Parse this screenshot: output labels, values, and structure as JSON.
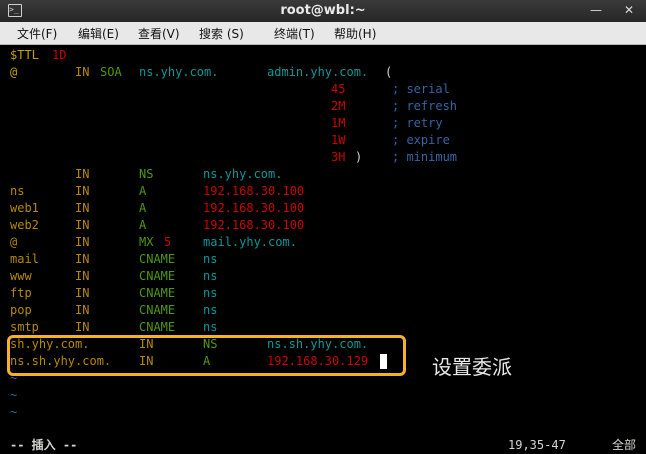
{
  "window": {
    "title": "root@wbl:~",
    "minimize": "—",
    "close": "✕",
    "terminal_icon": ">_"
  },
  "menu": [
    "文件(F)",
    "编辑(E)",
    "查看(V)",
    "搜索 (S)",
    "终端(T)",
    "帮助(H)"
  ],
  "file": {
    "ttl_key": "$TTL",
    "ttl_val": "1D",
    "soa": {
      "origin": "@",
      "class": "IN",
      "type": "SOA",
      "ns": "ns.yhy.com.",
      "admin": "admin.yhy.com.",
      "open": "("
    },
    "soa_fields": [
      {
        "value": "45",
        "close": "",
        "comment": "; serial"
      },
      {
        "value": "2M",
        "close": "",
        "comment": "; refresh"
      },
      {
        "value": "1M",
        "close": "",
        "comment": "; retry"
      },
      {
        "value": "1W",
        "close": "",
        "comment": "; expire"
      },
      {
        "value": "3H",
        "close": ")",
        "comment": "; minimum"
      }
    ],
    "records": [
      {
        "name": "",
        "class": "IN",
        "type": "NS",
        "pref": "",
        "data": "ns.yhy.com."
      },
      {
        "name": "ns",
        "class": "IN",
        "type": "A",
        "pref": "",
        "data": "192.168.30.100"
      },
      {
        "name": "web1",
        "class": "IN",
        "type": "A",
        "pref": "",
        "data": "192.168.30.100"
      },
      {
        "name": "web2",
        "class": "IN",
        "type": "A",
        "pref": "",
        "data": "192.168.30.100"
      },
      {
        "name": "@",
        "class": "IN",
        "type": "MX",
        "pref": "5",
        "data": "mail.yhy.com."
      },
      {
        "name": "mail",
        "class": "IN",
        "type": "CNAME",
        "pref": "",
        "data": "ns"
      },
      {
        "name": "www",
        "class": "IN",
        "type": "CNAME",
        "pref": "",
        "data": "ns"
      },
      {
        "name": "ftp",
        "class": "IN",
        "type": "CNAME",
        "pref": "",
        "data": "ns"
      },
      {
        "name": "pop",
        "class": "IN",
        "type": "CNAME",
        "pref": "",
        "data": "ns"
      },
      {
        "name": "smtp",
        "class": "IN",
        "type": "CNAME",
        "pref": "",
        "data": "ns"
      }
    ],
    "delegation": [
      {
        "name": "sh.yhy.com.",
        "class": "IN",
        "type": "NS",
        "data": "ns.sh.yhy.com."
      },
      {
        "name": "ns.sh.yhy.com.",
        "class": "IN",
        "type": "A",
        "data": "192.168.30.129"
      }
    ],
    "tildes": [
      "~",
      "~",
      "~"
    ]
  },
  "annotation": "设置委派",
  "status": {
    "mode": "-- 插入 --",
    "position": "19,35-47",
    "scroll": "全部"
  },
  "colors": {
    "name": "#b58900",
    "type": "#4e9a06",
    "data": "#06989a",
    "number": "#cc0000",
    "comment": "#3465a4",
    "highlight_border": "#f5b31f"
  }
}
